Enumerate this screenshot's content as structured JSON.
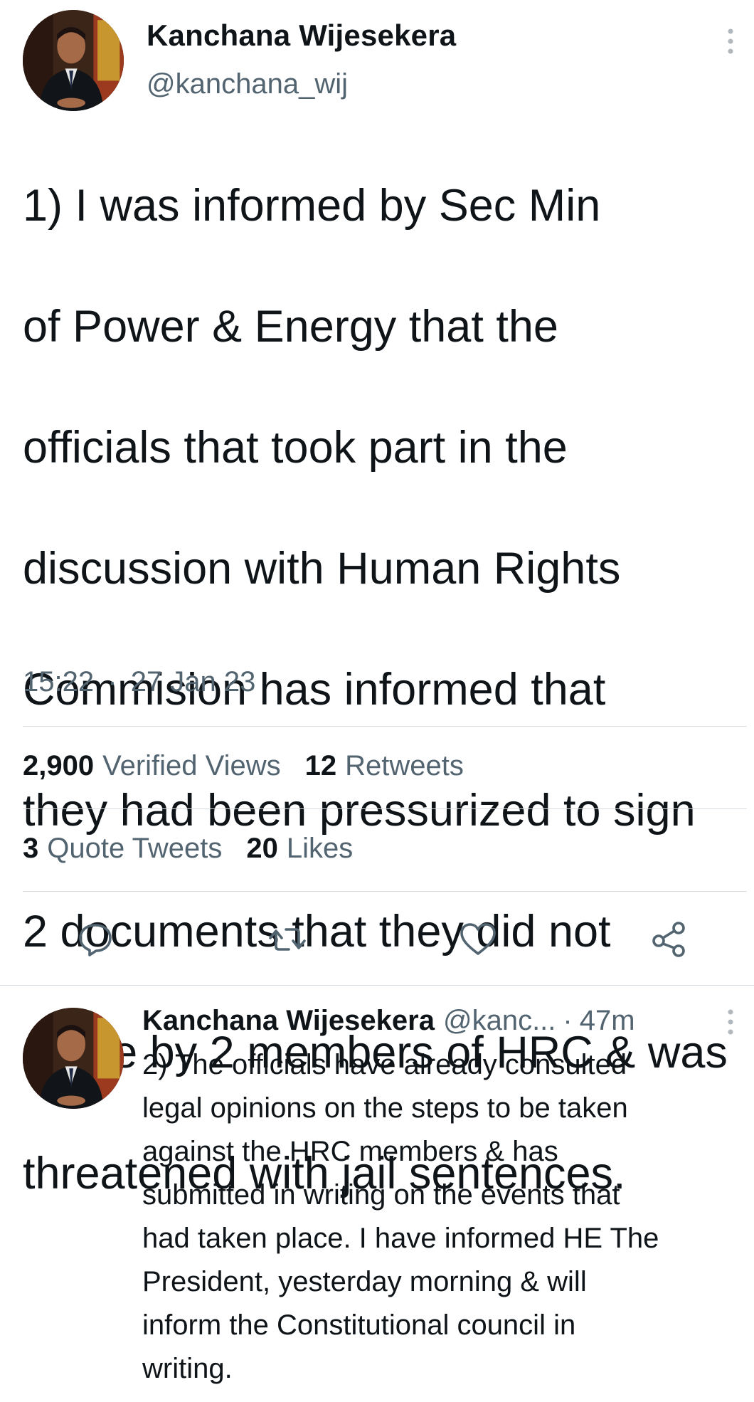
{
  "main_tweet": {
    "author_name": "Kanchana Wijesekera",
    "author_handle": "@kanchana_wij",
    "text_lines": [
      "1) I was informed by Sec Min",
      "of Power & Energy that the",
      "officials that took part in the",
      "discussion with Human Rights",
      "Commision has informed that",
      "they had been pressurized to sign",
      "2 documents that they did not",
      "agree by 2 members of HRC & was",
      "threatened with jail sentences."
    ],
    "time": "15:22",
    "separator": "·",
    "date": "27 Jan 23",
    "stats": {
      "views_count": "2,900",
      "views_label": "Verified Views",
      "retweets_count": "12",
      "retweets_label": "Retweets",
      "quotes_count": "3",
      "quotes_label": "Quote Tweets",
      "likes_count": "20",
      "likes_label": "Likes"
    },
    "actions": {
      "reply_icon": "reply-icon",
      "retweet_icon": "retweet-icon",
      "like_icon": "heart-icon",
      "share_icon": "share-icon"
    }
  },
  "reply_tweet": {
    "author_name": "Kanchana Wijesekera",
    "author_handle": "@kanc...",
    "separator": "·",
    "time": "47m",
    "text_lines": [
      "2) The officials have already consulted",
      "legal opinions on the steps to be taken",
      "against the HRC members & has",
      "submitted in writing on the events that",
      "had taken place. I have informed HE The",
      "President, yesterday morning & will",
      "inform the Constitutional council in",
      "writing."
    ]
  },
  "colors": {
    "text_primary": "#0f1419",
    "text_secondary": "#536471",
    "divider": "#d8dde1"
  }
}
